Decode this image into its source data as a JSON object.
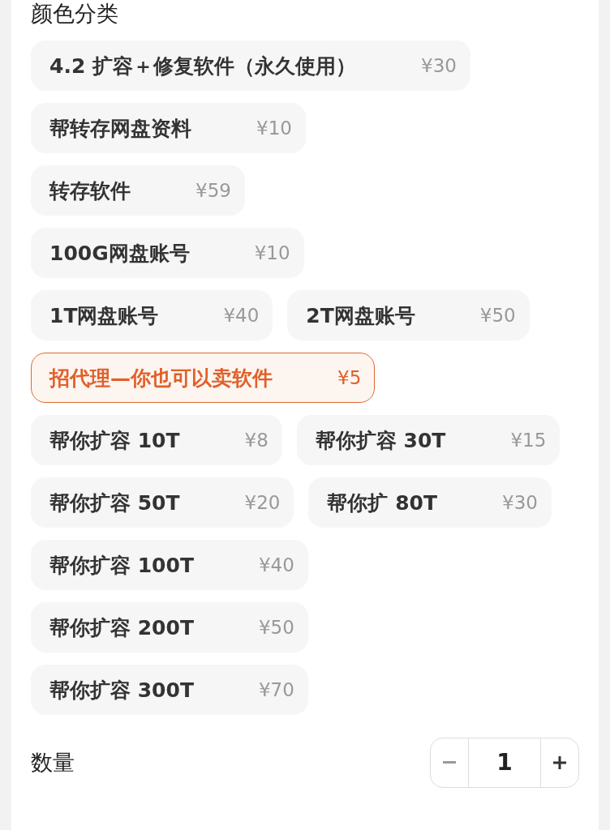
{
  "section_title": "颜色分类",
  "options": [
    {
      "label": "4.2 扩容＋修复软件（永久使用）",
      "price": "¥30",
      "selected": false
    },
    {
      "label": "帮转存网盘资料",
      "price": "¥10",
      "selected": false
    },
    {
      "label": "转存软件",
      "price": "¥59",
      "selected": false
    },
    {
      "label": "100G网盘账号",
      "price": "¥10",
      "selected": false
    },
    {
      "label": "1T网盘账号",
      "price": "¥40",
      "selected": false
    },
    {
      "label": "2T网盘账号",
      "price": "¥50",
      "selected": false
    },
    {
      "label": "招代理—你也可以卖软件",
      "price": "¥5",
      "selected": true
    },
    {
      "label": "帮你扩容 10T",
      "price": "¥8",
      "selected": false
    },
    {
      "label": "帮你扩容 30T",
      "price": "¥15",
      "selected": false
    },
    {
      "label": "帮你扩容 50T",
      "price": "¥20",
      "selected": false
    },
    {
      "label": "帮你扩 80T",
      "price": "¥30",
      "selected": false
    },
    {
      "label": "帮你扩容 100T",
      "price": "¥40",
      "selected": false
    },
    {
      "label": "帮你扩容 200T",
      "price": "¥50",
      "selected": false
    },
    {
      "label": "帮你扩容 300T",
      "price": "¥70",
      "selected": false
    }
  ],
  "quantity": {
    "label": "数量",
    "value": "1"
  }
}
